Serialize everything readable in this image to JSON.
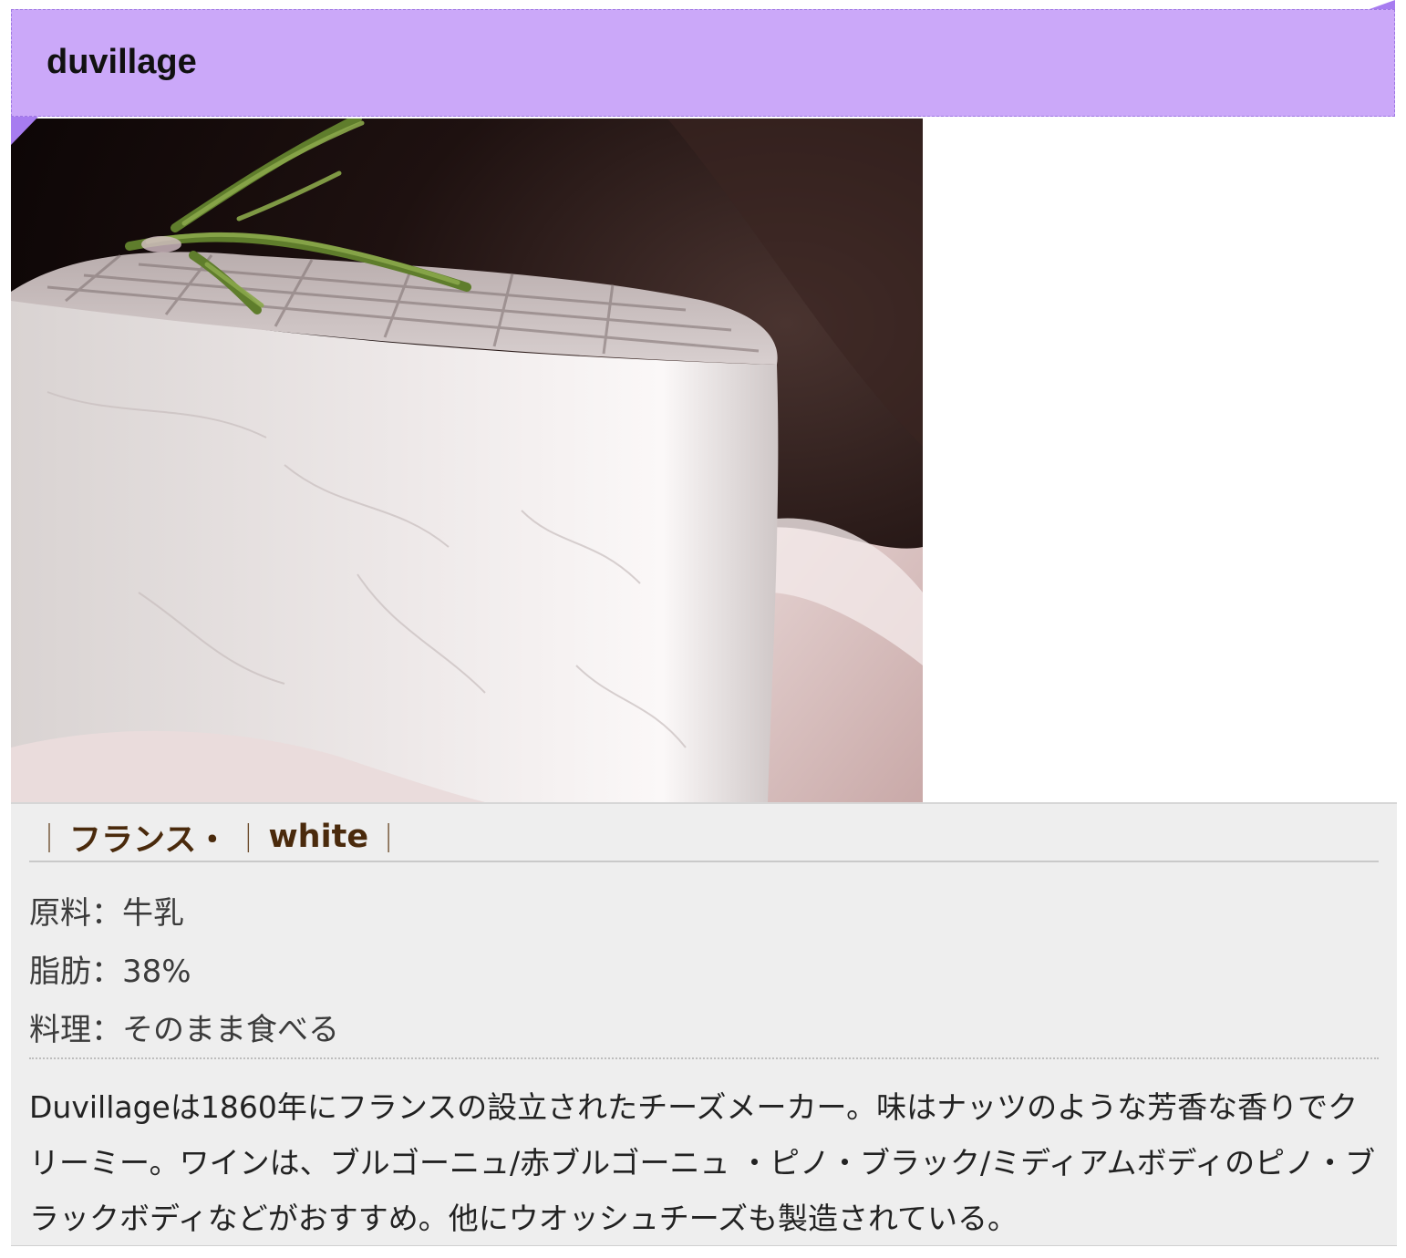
{
  "header": {
    "title": "duvillage"
  },
  "product_image": {
    "alt": "duvillage cheese with rosemary"
  },
  "tags": [
    {
      "label": "フランス・"
    },
    {
      "label": "white"
    }
  ],
  "specs": [
    {
      "label": "原料",
      "value": "牛乳"
    },
    {
      "label": "脂肪",
      "value": "38%"
    },
    {
      "label": "料理",
      "value": "そのまま食べる"
    }
  ],
  "spec_separator": "：",
  "tag_separator": "｜",
  "description": "Duvillageは1860年にフランスの設立されたチーズメーカー。味はナッツのような芳香な香りでクリーミー。ワインは、ブルゴーニュ/赤ブルゴーニュ ・ピノ・ブラック/ミディアムボディのピノ・ブラックボディなどがおすすめ。他にウオッシュチーズも製造されている。",
  "colors": {
    "title_bar": "#cba8f9",
    "ribbon_fold": "#a77cf0",
    "info_panel": "#eeeeee",
    "tag_text": "#4a2a0c"
  }
}
